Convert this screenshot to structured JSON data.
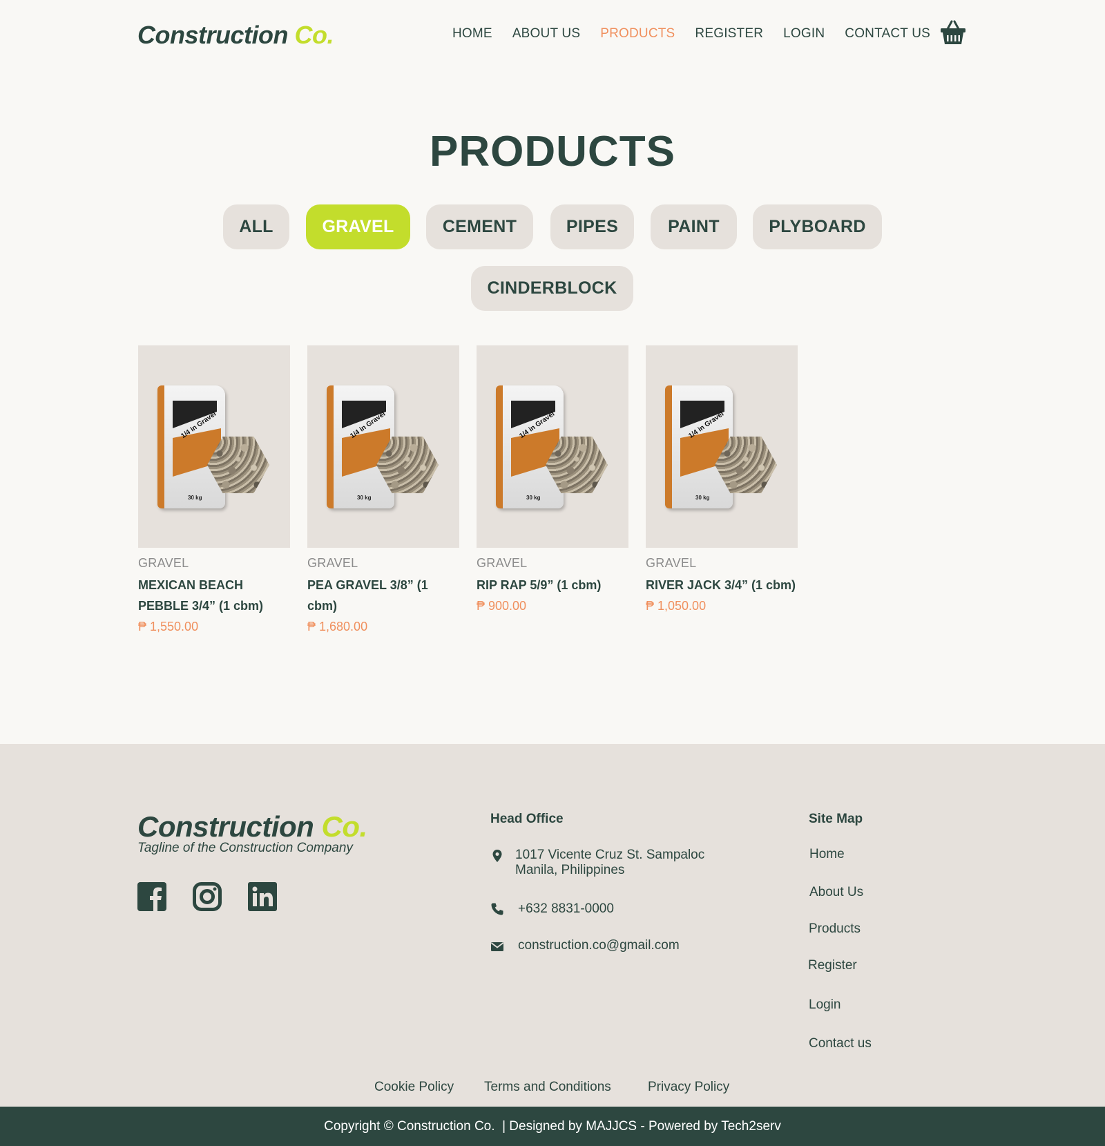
{
  "brand": {
    "name": "Construction",
    "accent": "Co."
  },
  "nav": {
    "items": [
      "HOME",
      "ABOUT US",
      "PRODUCTS",
      "REGISTER",
      "LOGIN",
      "CONTACT US"
    ],
    "active": "PRODUCTS",
    "cart_icon": "basket-icon"
  },
  "page": {
    "title": "PRODUCTS"
  },
  "filters": {
    "items": [
      "ALL",
      "GRAVEL",
      "CEMENT",
      "PIPES",
      "PAINT",
      "PLYBOARD",
      "CINDERBLOCK"
    ],
    "active": "GRAVEL"
  },
  "products": [
    {
      "category": "GRAVEL",
      "name": "MEXICAN BEACH PEBBLE 3/4” (1 cbm)",
      "price": "₱ 1,550.00",
      "bag_label": "1/4 in Gravel",
      "bag_weight": "30 kg"
    },
    {
      "category": "GRAVEL",
      "name": "PEA GRAVEL 3/8” (1 cbm)",
      "price": "₱ 1,680.00",
      "bag_label": "1/4 in Gravel",
      "bag_weight": "30 kg"
    },
    {
      "category": "GRAVEL",
      "name": "RIP RAP 5/9” (1 cbm)",
      "price": "₱ 900.00",
      "bag_label": "1/4 in Gravel",
      "bag_weight": "30 kg"
    },
    {
      "category": "GRAVEL",
      "name": "RIVER JACK 3/4” (1 cbm)",
      "price": "₱ 1,050.00",
      "bag_label": "1/4 in Gravel",
      "bag_weight": "30 kg"
    }
  ],
  "footer": {
    "brand": {
      "name": "Construction",
      "accent": "Co."
    },
    "tagline": "Tagline of the Construction Company",
    "social": [
      "facebook-icon",
      "instagram-icon",
      "linkedin-icon"
    ],
    "head_office": {
      "heading": "Head Office",
      "address_line1": "1017 Vicente Cruz St. Sampaloc",
      "address_line2": "Manila, Philippines",
      "phone": "+632 8831-0000",
      "email": "construction.co@gmail.com"
    },
    "site_map": {
      "heading": "Site Map",
      "items": [
        "Home",
        "About Us",
        "Products",
        "Register",
        "Login",
        "Contact us"
      ]
    },
    "legal": [
      "Cookie Policy",
      "Terms and Conditions",
      "Privacy Policy"
    ],
    "copyright": "Copyright © Construction Co.  | Designed by MAJJCS - Powered by Tech2serv"
  },
  "colors": {
    "primary": "#2d4740",
    "accent_green": "#c3dd2c",
    "accent_orange": "#f0905e",
    "pill_bg": "#e6e1dc",
    "page_bg": "#f9f8f5"
  }
}
